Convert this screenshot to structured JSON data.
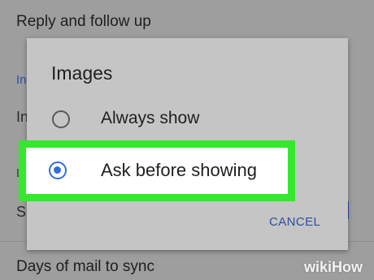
{
  "background": {
    "top_item": "Reply and follow up",
    "bottom_item": "Days of mail to sync",
    "fragments": [
      "In",
      "In",
      "D",
      "S"
    ]
  },
  "dialog": {
    "title": "Images",
    "options": [
      {
        "label": "Always show",
        "selected": false
      },
      {
        "label": "Ask before showing",
        "selected": true
      }
    ],
    "cancel_label": "CANCEL",
    "highlight_color": "#33e82d",
    "accent_color": "#2f6fd8"
  },
  "watermark": {
    "text": "wikiHow"
  }
}
